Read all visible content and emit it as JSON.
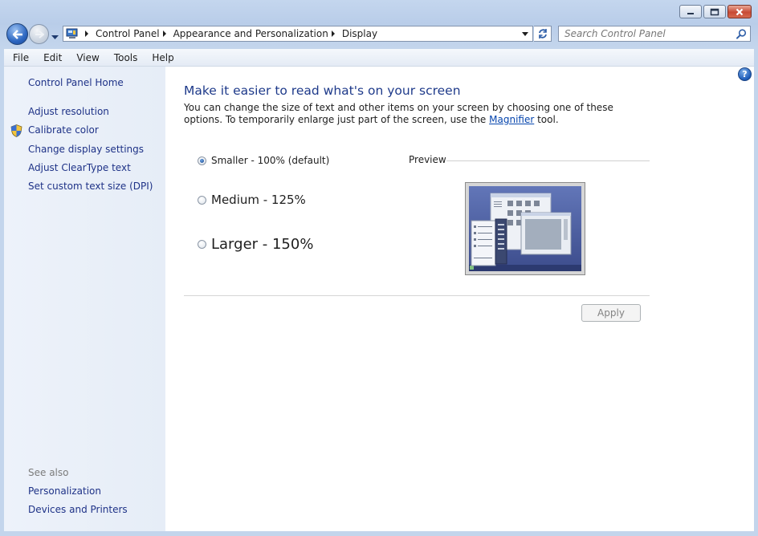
{
  "window": {
    "caption_buttons": [
      "minimize",
      "maximize",
      "close"
    ]
  },
  "navbar": {
    "breadcrumbs": [
      "Control Panel",
      "Appearance and Personalization",
      "Display"
    ],
    "search_placeholder": "Search Control Panel"
  },
  "menu": {
    "items": [
      "File",
      "Edit",
      "View",
      "Tools",
      "Help"
    ]
  },
  "sidebar": {
    "home": "Control Panel Home",
    "links": [
      "Adjust resolution",
      "Calibrate color",
      "Change display settings",
      "Adjust ClearType text",
      "Set custom text size (DPI)"
    ],
    "see_also_label": "See also",
    "see_also": [
      "Personalization",
      "Devices and Printers"
    ]
  },
  "main": {
    "title": "Make it easier to read what's on your screen",
    "description_before": "You can change the size of text and other items on your screen by choosing one of these options. To temporarily enlarge just part of the screen, use the ",
    "description_link": "Magnifier",
    "description_after": " tool.",
    "options": [
      {
        "label": "Smaller - 100% (default)",
        "checked": true
      },
      {
        "label": "Medium - 125%",
        "checked": false
      },
      {
        "label": "Larger - 150%",
        "checked": false
      }
    ],
    "preview_label": "Preview",
    "apply_label": "Apply"
  },
  "colors": {
    "link": "#1e3287",
    "title": "#1e3a8a",
    "sidebar_bg": "#e6edf7",
    "chrome": "#b9cde9"
  }
}
